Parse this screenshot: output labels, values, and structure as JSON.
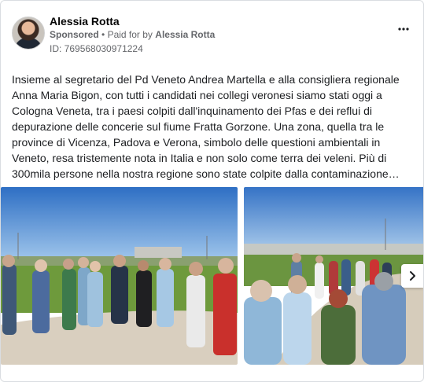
{
  "ad": {
    "advertiser_name": "Alessia Rotta",
    "sponsored_label": "Sponsored",
    "separator": "•",
    "paid_for_by_label": "Paid for by",
    "paid_for_by_name": "Alessia Rotta",
    "id_text": "ID: 769568030971224",
    "more_icon": "more-dots-icon",
    "body_text": "Insieme al segretario del Pd Veneto Andrea Martella e alla consigliera regionale Anna Maria Bigon, con tutti i candidati nei collegi veronesi siamo stati oggi a Cologna Veneta, tra i paesi colpiti dall'inquinamento dei Pfas e dei reflui di depurazione delle concerie sul fiume Fratta Gorzone. Una zona, quella tra le province di Vicenza, Padova e Verona, simbolo delle questioni ambientali in Veneto, resa tristemente nota in Italia e non solo come terra dei veleni. Più di 300mila persone nella nostra regione sono state colpite dalla contaminazione…"
  },
  "carousel": {
    "photos": [
      "group-outdoor-photo-1",
      "group-outdoor-photo-2"
    ],
    "next_icon": "chevron-right-icon"
  },
  "colors": {
    "text_primary": "#1c1e21",
    "text_secondary": "#65676b",
    "sky": "#4f8fd6",
    "grass": "#6e9a3c",
    "path": "#d9cfbf"
  }
}
